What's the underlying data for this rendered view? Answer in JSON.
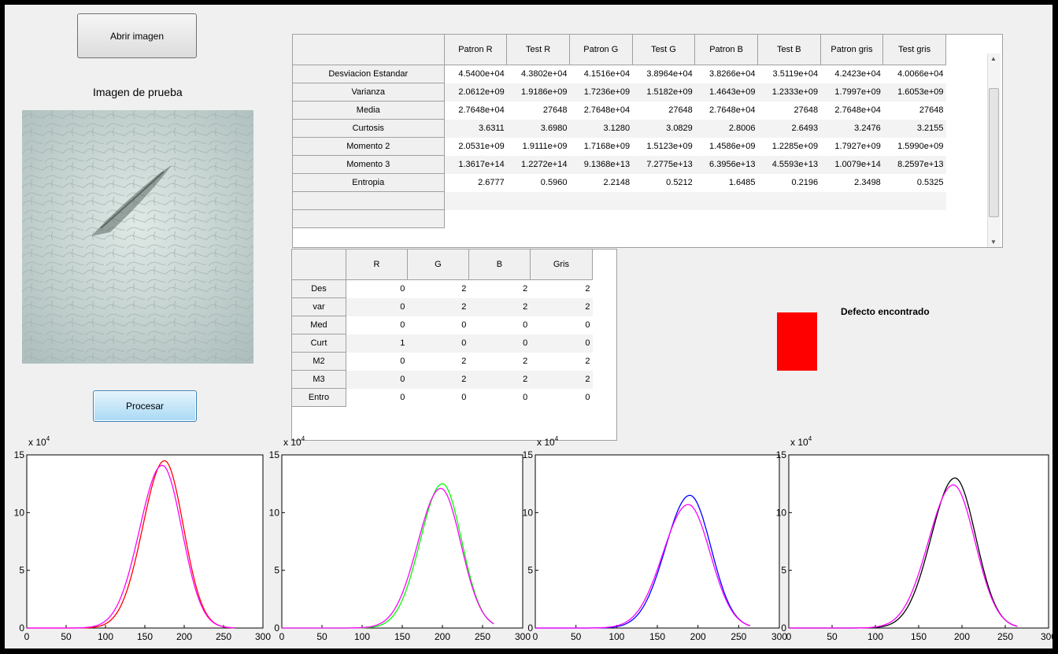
{
  "buttons": {
    "open": "Abrir imagen",
    "process": "Procesar"
  },
  "labels": {
    "image_title": "Imagen de prueba",
    "defect": "Defecto encontrado"
  },
  "indicator_color": "#ff0000",
  "stats_table": {
    "columns": [
      "Patron R",
      "Test R",
      "Patron G",
      "Test G",
      "Patron B",
      "Test B",
      "Patron gris",
      "Test gris"
    ],
    "rows": [
      {
        "label": "Desviacion Estandar",
        "values": [
          "4.5400e+04",
          "4.3802e+04",
          "4.1516e+04",
          "3.8964e+04",
          "3.8266e+04",
          "3.5119e+04",
          "4.2423e+04",
          "4.0066e+04"
        ]
      },
      {
        "label": "Varianza",
        "values": [
          "2.0612e+09",
          "1.9186e+09",
          "1.7236e+09",
          "1.5182e+09",
          "1.4643e+09",
          "1.2333e+09",
          "1.7997e+09",
          "1.6053e+09"
        ]
      },
      {
        "label": "Media",
        "values": [
          "2.7648e+04",
          "27648",
          "2.7648e+04",
          "27648",
          "2.7648e+04",
          "27648",
          "2.7648e+04",
          "27648"
        ]
      },
      {
        "label": "Curtosis",
        "values": [
          "3.6311",
          "3.6980",
          "3.1280",
          "3.0829",
          "2.8006",
          "2.6493",
          "3.2476",
          "3.2155"
        ]
      },
      {
        "label": "Momento 2",
        "values": [
          "2.0531e+09",
          "1.9111e+09",
          "1.7168e+09",
          "1.5123e+09",
          "1.4586e+09",
          "1.2285e+09",
          "1.7927e+09",
          "1.5990e+09"
        ]
      },
      {
        "label": "Momento 3",
        "values": [
          "1.3617e+14",
          "1.2272e+14",
          "9.1368e+13",
          "7.2775e+13",
          "6.3956e+13",
          "4.5593e+13",
          "1.0079e+14",
          "8.2597e+13"
        ]
      },
      {
        "label": "Entropia",
        "values": [
          "2.6777",
          "0.5960",
          "2.2148",
          "0.5212",
          "1.6485",
          "0.2196",
          "2.3498",
          "0.5325"
        ]
      },
      {
        "label": "",
        "values": [
          "",
          "",
          "",
          "",
          "",
          "",
          "",
          ""
        ]
      },
      {
        "label": "",
        "values": [
          "",
          "",
          "",
          "",
          "",
          "",
          "",
          ""
        ]
      }
    ]
  },
  "result_table": {
    "columns": [
      "R",
      "G",
      "B",
      "Gris"
    ],
    "rows": [
      {
        "label": "Des",
        "values": [
          "0",
          "2",
          "2",
          "2"
        ]
      },
      {
        "label": "var",
        "values": [
          "0",
          "2",
          "2",
          "2"
        ]
      },
      {
        "label": "Med",
        "values": [
          "0",
          "0",
          "0",
          "0"
        ]
      },
      {
        "label": "Curt",
        "values": [
          "1",
          "0",
          "0",
          "0"
        ]
      },
      {
        "label": "M2",
        "values": [
          "0",
          "2",
          "2",
          "2"
        ]
      },
      {
        "label": "M3",
        "values": [
          "0",
          "2",
          "2",
          "2"
        ]
      },
      {
        "label": "Entro",
        "values": [
          "0",
          "0",
          "0",
          "0"
        ]
      }
    ]
  },
  "chart_data": [
    {
      "type": "line",
      "multiplier_label": "x 10",
      "multiplier_exp": "4",
      "xlim": [
        0,
        300
      ],
      "ylim": [
        0,
        15
      ],
      "xticks": [
        0,
        50,
        100,
        150,
        200,
        250,
        300
      ],
      "yticks": [
        0,
        5,
        10,
        15
      ],
      "series": [
        {
          "color": "#ff0000",
          "peak_x": 175,
          "peak_y": 14.5,
          "sigma": 24
        },
        {
          "color": "#ff00ff",
          "peak_x": 172,
          "peak_y": 14.1,
          "sigma": 25
        }
      ]
    },
    {
      "type": "line",
      "multiplier_label": "x 10",
      "multiplier_exp": "4",
      "xlim": [
        0,
        300
      ],
      "ylim": [
        0,
        15
      ],
      "xticks": [
        0,
        50,
        100,
        150,
        200,
        250,
        300
      ],
      "yticks": [
        0,
        5,
        10,
        15
      ],
      "series": [
        {
          "color": "#00ff00",
          "peak_x": 200,
          "peak_y": 12.5,
          "sigma": 24
        },
        {
          "color": "#ff00ff",
          "peak_x": 198,
          "peak_y": 12.1,
          "sigma": 25
        }
      ]
    },
    {
      "type": "line",
      "multiplier_label": "x 10",
      "multiplier_exp": "4",
      "xlim": [
        0,
        300
      ],
      "ylim": [
        0,
        15
      ],
      "xticks": [
        0,
        50,
        100,
        150,
        200,
        250,
        300
      ],
      "yticks": [
        0,
        5,
        10,
        15
      ],
      "series": [
        {
          "color": "#0000ff",
          "peak_x": 190,
          "peak_y": 11.5,
          "sigma": 26
        },
        {
          "color": "#ff00ff",
          "peak_x": 188,
          "peak_y": 10.7,
          "sigma": 27
        }
      ]
    },
    {
      "type": "line",
      "multiplier_label": "x 10",
      "multiplier_exp": "4",
      "xlim": [
        0,
        300
      ],
      "ylim": [
        0,
        15
      ],
      "xticks": [
        0,
        50,
        100,
        150,
        200,
        250,
        300
      ],
      "yticks": [
        0,
        5,
        10,
        15
      ],
      "series": [
        {
          "color": "#000000",
          "peak_x": 192,
          "peak_y": 13.0,
          "sigma": 24
        },
        {
          "color": "#ff00ff",
          "peak_x": 190,
          "peak_y": 12.4,
          "sigma": 25
        }
      ]
    }
  ]
}
